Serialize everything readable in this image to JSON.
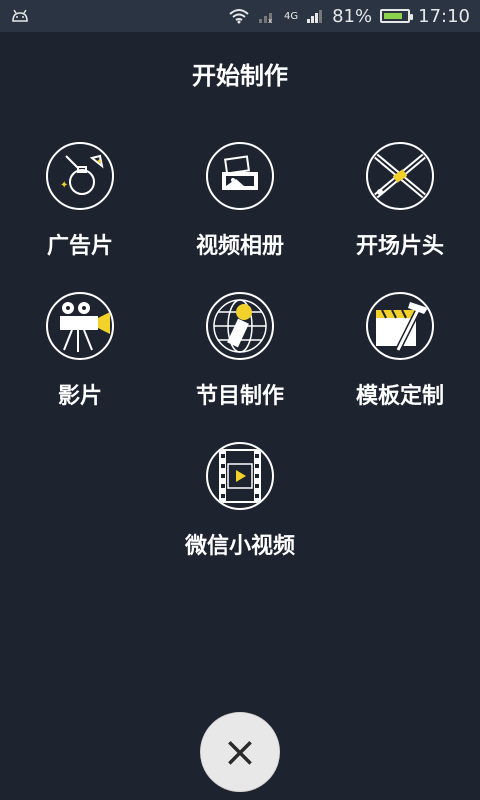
{
  "status": {
    "network": "4G",
    "battery_percent": "81%",
    "time": "17:10"
  },
  "title": "开始制作",
  "items": [
    {
      "label": "广告片",
      "icon": "perfume-icon"
    },
    {
      "label": "视频相册",
      "icon": "photo-album-icon"
    },
    {
      "label": "开场片头",
      "icon": "crossed-tape-icon"
    },
    {
      "label": "影片",
      "icon": "film-projector-icon"
    },
    {
      "label": "节目制作",
      "icon": "microphone-globe-icon"
    },
    {
      "label": "模板定制",
      "icon": "clapper-hammer-icon"
    },
    {
      "label": "微信小视频",
      "icon": "filmstrip-play-icon"
    }
  ],
  "close_label": "×",
  "colors": {
    "background": "#1e2330",
    "statusbar": "#2b3443",
    "accent_yellow": "#f2d12b",
    "close_button": "#e8e8e8"
  }
}
